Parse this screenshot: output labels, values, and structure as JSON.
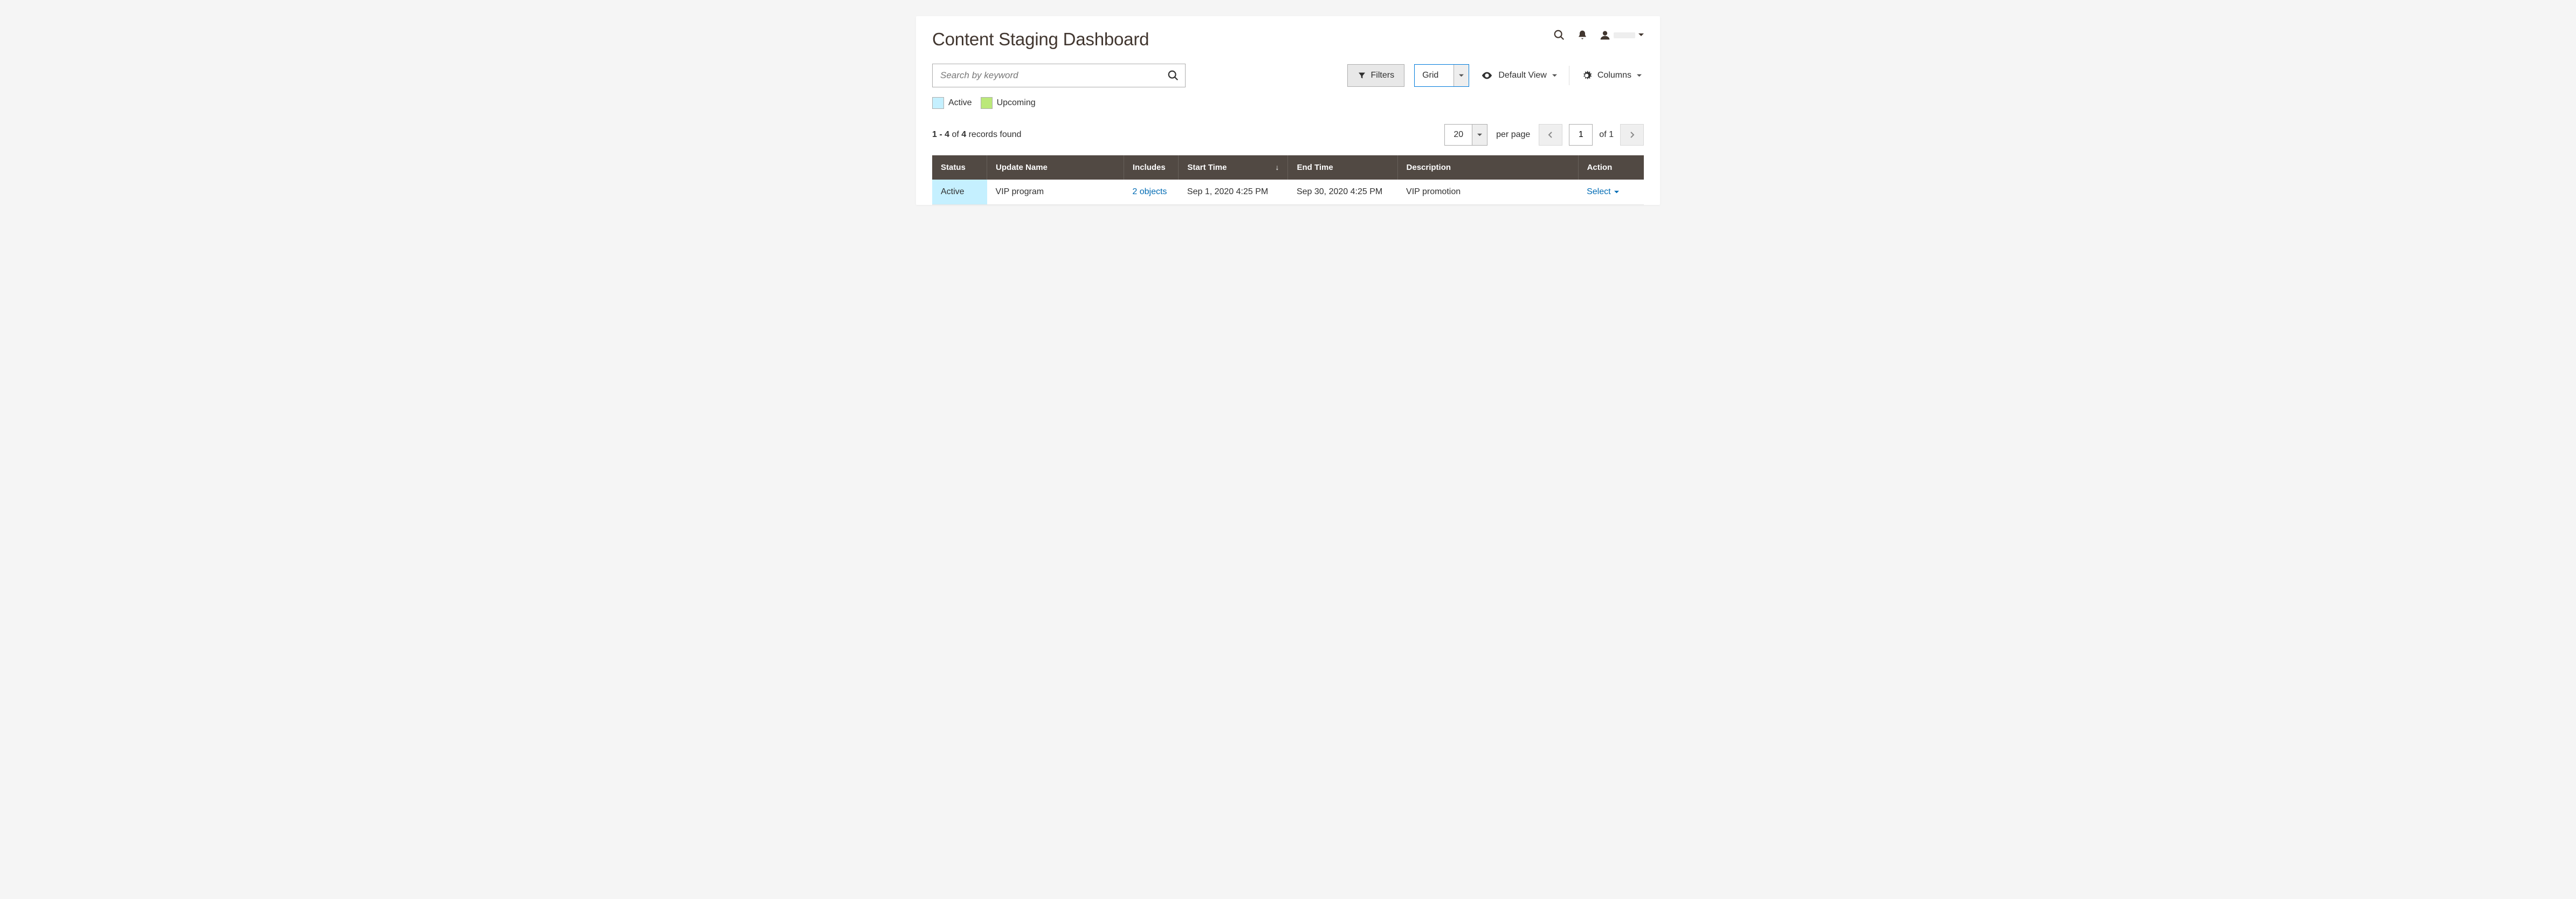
{
  "page_title": "Content Staging Dashboard",
  "search": {
    "placeholder": "Search by keyword"
  },
  "filters_label": "Filters",
  "layout_select": {
    "value": "Grid"
  },
  "default_view_label": "Default View",
  "columns_label": "Columns",
  "legend": {
    "active": "Active",
    "upcoming": "Upcoming"
  },
  "records": {
    "range": "1 - 4",
    "of_word": " of ",
    "total": "4",
    "suffix": " records found"
  },
  "paging": {
    "page_size": "20",
    "per_page_label": "per page",
    "current_page": "1",
    "of_word": "of ",
    "total_pages": "1"
  },
  "columns": {
    "status": "Status",
    "update_name": "Update Name",
    "includes": "Includes",
    "start_time": "Start Time",
    "end_time": "End Time",
    "description": "Description",
    "action": "Action"
  },
  "rows": [
    {
      "status": "Active",
      "update_name": "VIP program",
      "includes": "2 objects",
      "start_time": "Sep 1, 2020 4:25 PM",
      "end_time": "Sep 30, 2020 4:25 PM",
      "description": "VIP promotion",
      "action": "Select"
    }
  ]
}
